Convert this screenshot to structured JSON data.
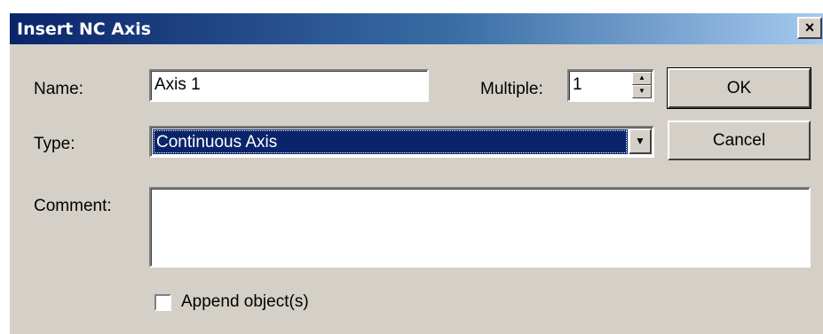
{
  "window": {
    "title": "Insert NC Axis",
    "close_glyph": "×"
  },
  "form": {
    "name_label": "Name:",
    "name_value": "Axis 1",
    "multiple_label": "Multiple:",
    "multiple_value": "1",
    "type_label": "Type:",
    "type_value": "Continuous Axis",
    "comment_label": "Comment:",
    "comment_value": "",
    "append_label": "Append object(s)",
    "append_checked": false
  },
  "buttons": {
    "ok_label": "OK",
    "cancel_label": "Cancel"
  },
  "icons": {
    "spin_up": "up-arrow-icon",
    "spin_down": "down-arrow-icon",
    "dropdown": "chevron-down-icon",
    "close": "close-icon"
  },
  "colors": {
    "dialog_bg": "#d4d0c8",
    "title_bar_start": "#0a246a",
    "title_bar_end": "#a6caf0",
    "selection": "#0a246a"
  }
}
